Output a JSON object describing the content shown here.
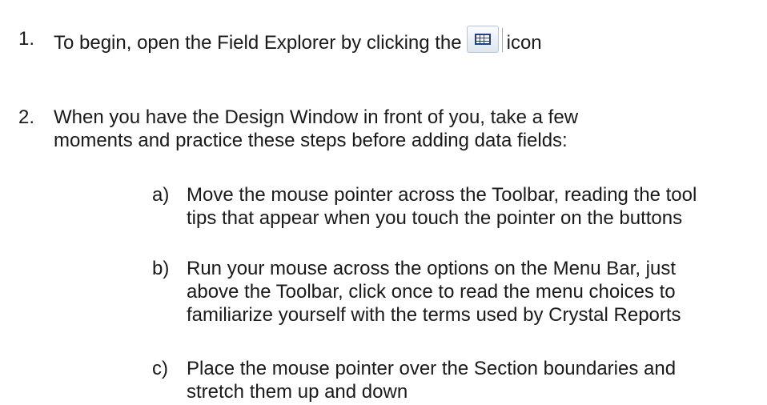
{
  "steps": [
    {
      "number": "1.",
      "text_before_icon": "To begin, open the Field Explorer by clicking the",
      "icon": "field-explorer-icon",
      "text_after_icon": "icon"
    },
    {
      "number": "2.",
      "lines": [
        "When you have the Design Window in front of you, take a few",
        "moments and practice these steps before adding data fields:"
      ],
      "substeps": [
        {
          "letter": "a)",
          "lines": [
            "Move the mouse pointer across the Toolbar, reading the tool",
            "tips that appear when you touch the pointer on the buttons"
          ]
        },
        {
          "letter": "b)",
          "lines": [
            "Run your mouse across the options on the Menu Bar, just",
            "above the Toolbar, click once to read the menu choices to",
            "familiarize yourself with the terms used by Crystal Reports"
          ]
        },
        {
          "letter": "c)",
          "lines": [
            "Place the mouse pointer over the Section boundaries and",
            "stretch them up and down"
          ]
        }
      ]
    }
  ],
  "colors": {
    "text": "#1a1a1a",
    "icon_accent": "#1f3f8f"
  }
}
